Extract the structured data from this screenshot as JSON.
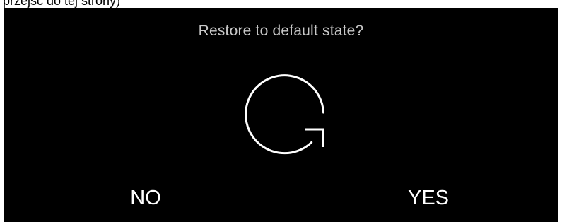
{
  "caption": {
    "text": "przejsć do tej strony)"
  },
  "dialog": {
    "title": "Restore to default state?",
    "icon": "restore-icon",
    "no_label": "NO",
    "yes_label": "YES"
  },
  "colors": {
    "background": "#000000",
    "title": "#c9c9c9",
    "button_text": "#ffffff",
    "icon_stroke": "#ffffff"
  }
}
